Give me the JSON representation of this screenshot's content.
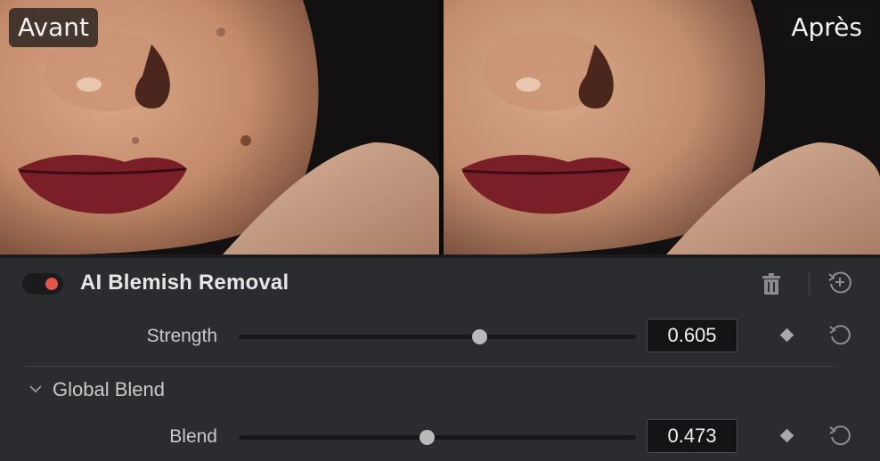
{
  "preview": {
    "before_label": "Avant",
    "after_label": "Après"
  },
  "effect": {
    "title": "AI Blemish Removal",
    "enabled": true,
    "toggle_color": "#e0564a",
    "icons": {
      "toggle": "toggle-switch-icon",
      "delete": "trash-icon",
      "reset_all": "reset-add-icon"
    }
  },
  "params": {
    "strength": {
      "label": "Strength",
      "value": "0.605",
      "slider_fraction": 0.605,
      "keyframe_icon": "diamond-keyframe-icon",
      "reset_icon": "reset-icon"
    },
    "blend": {
      "label": "Blend",
      "value": "0.473",
      "slider_fraction": 0.473,
      "keyframe_icon": "diamond-keyframe-icon",
      "reset_icon": "reset-icon"
    }
  },
  "group": {
    "title": "Global Blend",
    "expanded": true,
    "chevron_icon": "chevron-down-icon"
  }
}
